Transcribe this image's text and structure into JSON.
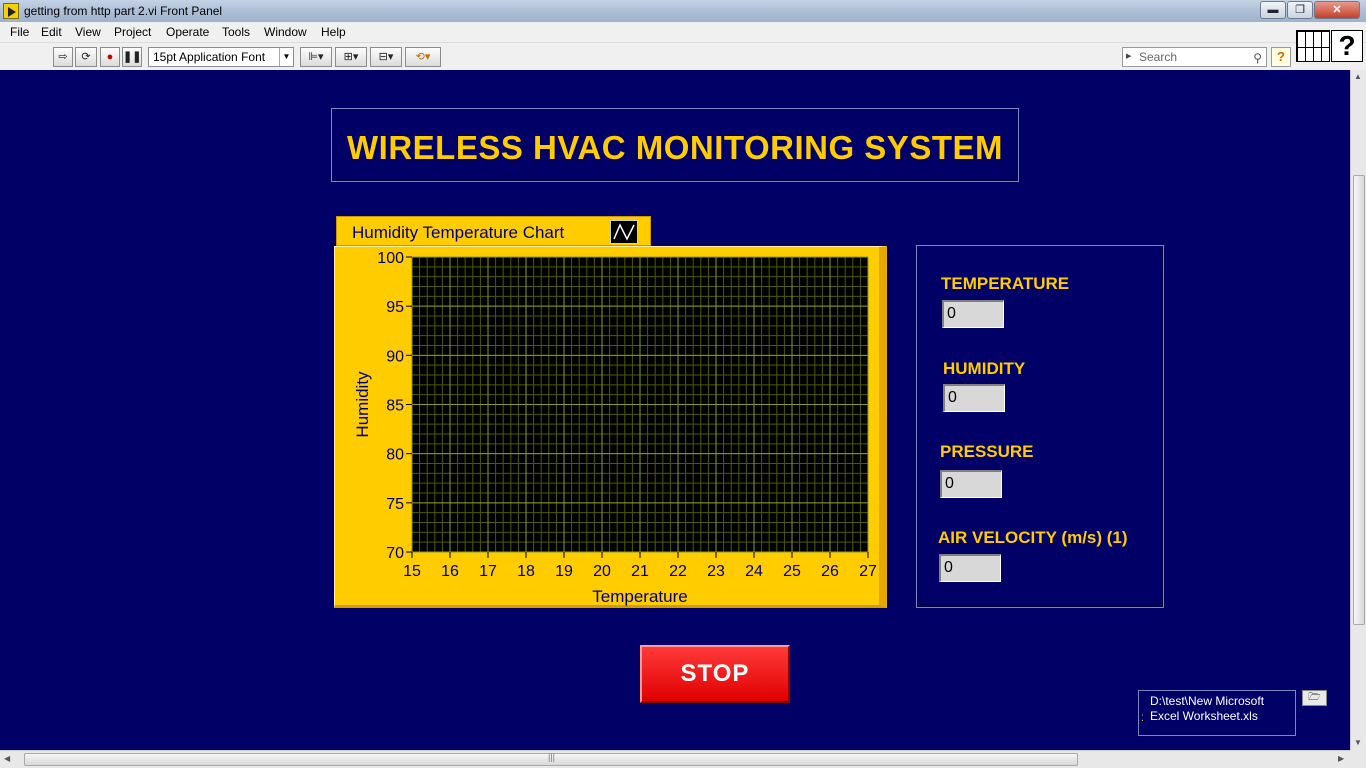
{
  "window": {
    "title": "getting from http part 2.vi Front Panel",
    "minimize_label": "▬",
    "maximize_label": "❐",
    "close_label": "✕"
  },
  "menu": [
    "File",
    "Edit",
    "View",
    "Project",
    "Operate",
    "Tools",
    "Window",
    "Help"
  ],
  "toolbar": {
    "font": "15pt Application Font",
    "search_placeholder": "Search",
    "help_label": "?",
    "vi_icon_label": "?"
  },
  "panel": {
    "title": "WIRELESS HVAC MONITORING SYSTEM",
    "stop_label": "STOP",
    "path_line1": "D:\\test\\New Microsoft",
    "path_line2": "Excel Worksheet.xls"
  },
  "indicators": [
    {
      "label": "TEMPERATURE",
      "value": "0"
    },
    {
      "label": "HUMIDITY",
      "value": "0"
    },
    {
      "label": "PRESSURE",
      "value": "0"
    },
    {
      "label": "AIR VELOCITY (m/s) (1)",
      "value": "0"
    }
  ],
  "colors": {
    "panel_bg": "#000066",
    "accent_yellow": "#ffcc00",
    "plot_bg": "#000000",
    "grid_minor": "#4d5a00",
    "grid_major": "#8a9a20",
    "stop_red": "#ff1a1a"
  },
  "chart_data": {
    "type": "line",
    "title": "Humidity Temperature Chart",
    "xlabel": "Temperature",
    "ylabel": "Humidity",
    "xlim": [
      15,
      27
    ],
    "ylim": [
      70,
      100
    ],
    "x_ticks": [
      15,
      16,
      17,
      18,
      19,
      20,
      21,
      22,
      23,
      24,
      25,
      26,
      27
    ],
    "y_ticks": [
      70,
      75,
      80,
      85,
      90,
      95,
      100
    ],
    "grid": true,
    "series": []
  }
}
